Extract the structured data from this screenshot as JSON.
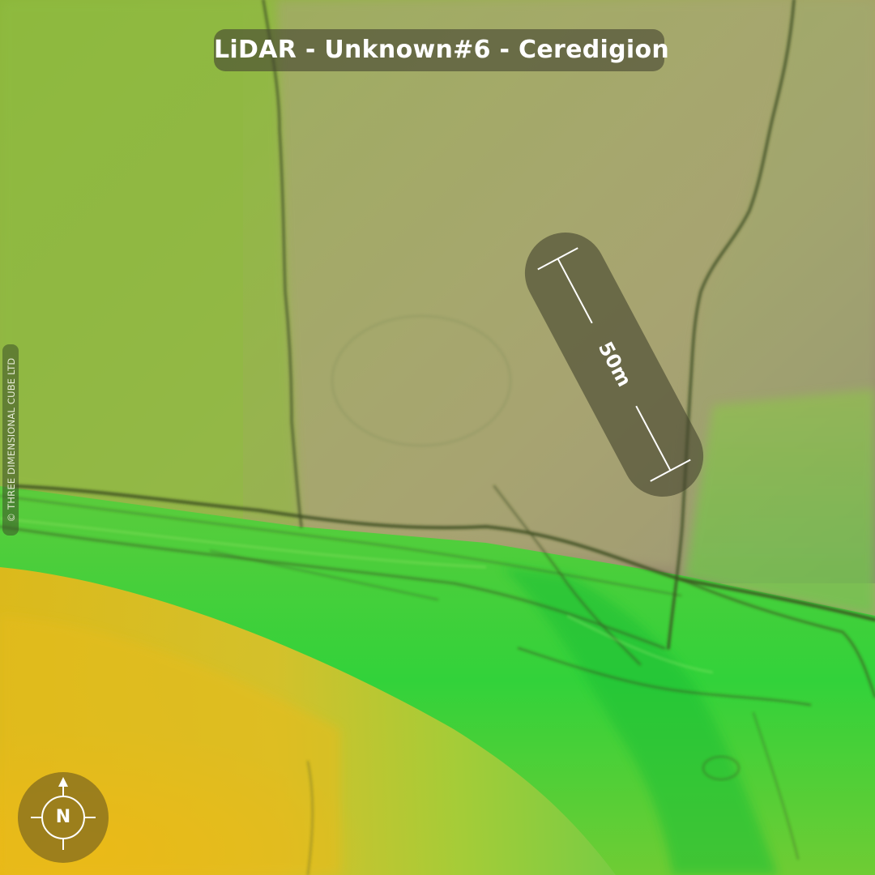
{
  "map": {
    "title": "LiDAR - Unknown#6 - Ceredigion",
    "copyright": "© THREE DIMENSIONAL CUBE LTD",
    "scale_label": "50m",
    "compass_label": "N",
    "layer": "LiDAR elevation hillshade",
    "colors": {
      "low_elevation": "#22c838",
      "mid_elevation": "#8fb83a",
      "high_elevation_plateau": "#a89e6a",
      "slope_yellow": "#e8c020",
      "overlay": "#46462f"
    },
    "icons": {
      "compass": "compass-rose-icon"
    }
  }
}
